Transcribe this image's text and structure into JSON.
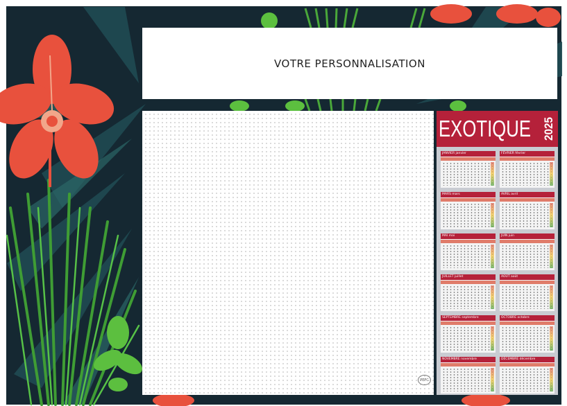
{
  "custom_banner": {
    "text": "VOTRE PERSONNALISATION"
  },
  "calendar": {
    "title": "EXOTIQUE",
    "year": "2025",
    "months": [
      "JANVIER janvier",
      "FÉVRIER février",
      "MARS mars",
      "AVRIL avril",
      "MAI mai",
      "JUIN juin",
      "JUILLET juillet",
      "AOÛT août",
      "SEPTEMBRE septembre",
      "OCTOBRE octobre",
      "NOVEMBRE novembre",
      "DÉCEMBRE décembre"
    ]
  },
  "stamp": {
    "text": "PEFC"
  },
  "colors": {
    "background": "#14262f",
    "leaf_green": "#4aa83a",
    "flower_red": "#e8513d",
    "calendar_red": "#b5213a"
  }
}
